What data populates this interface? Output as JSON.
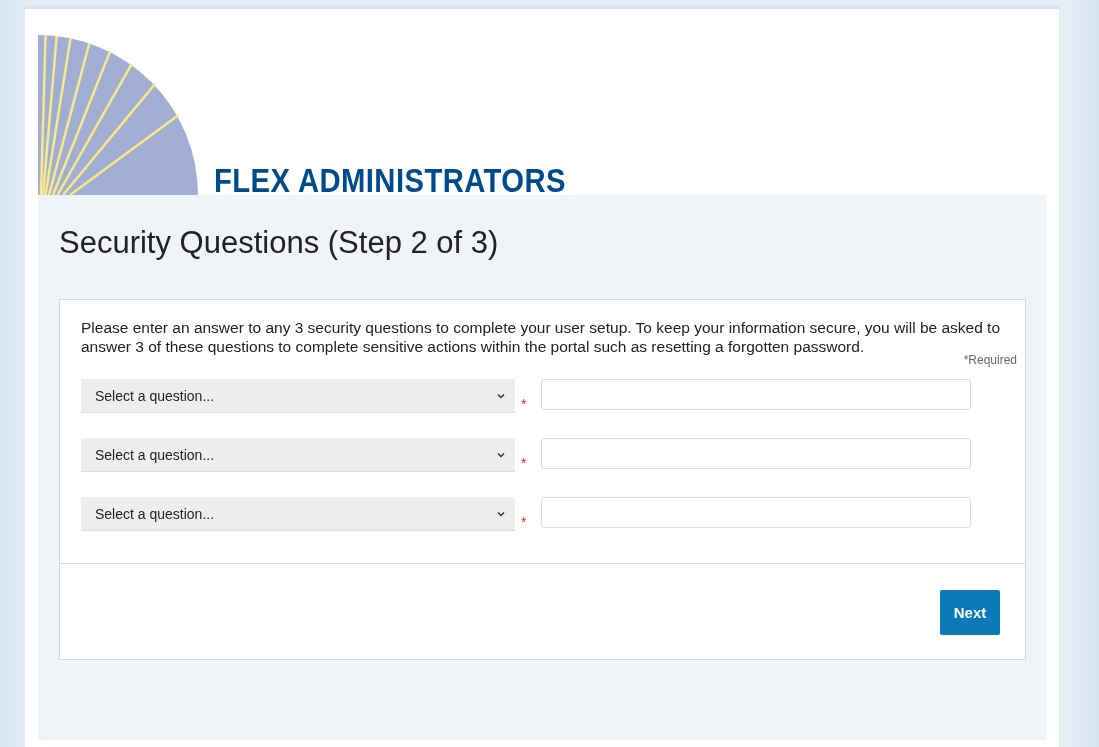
{
  "logo": {
    "text": "FLEX ADMINISTRATORS"
  },
  "title": "Security Questions (Step 2 of 3)",
  "intro": "Please enter an answer to any 3 security questions to complete your user setup. To keep your information secure, you will be asked to answer 3 of these questions to complete sensitive actions within the portal such as resetting a forgotten password.",
  "required_note": "*Required",
  "questions": [
    {
      "placeholder": "Select a question...",
      "required_mark": "*"
    },
    {
      "placeholder": "Select a question...",
      "required_mark": "*"
    },
    {
      "placeholder": "Select a question...",
      "required_mark": "*"
    }
  ],
  "buttons": [
    {
      "label": "Next"
    }
  ]
}
